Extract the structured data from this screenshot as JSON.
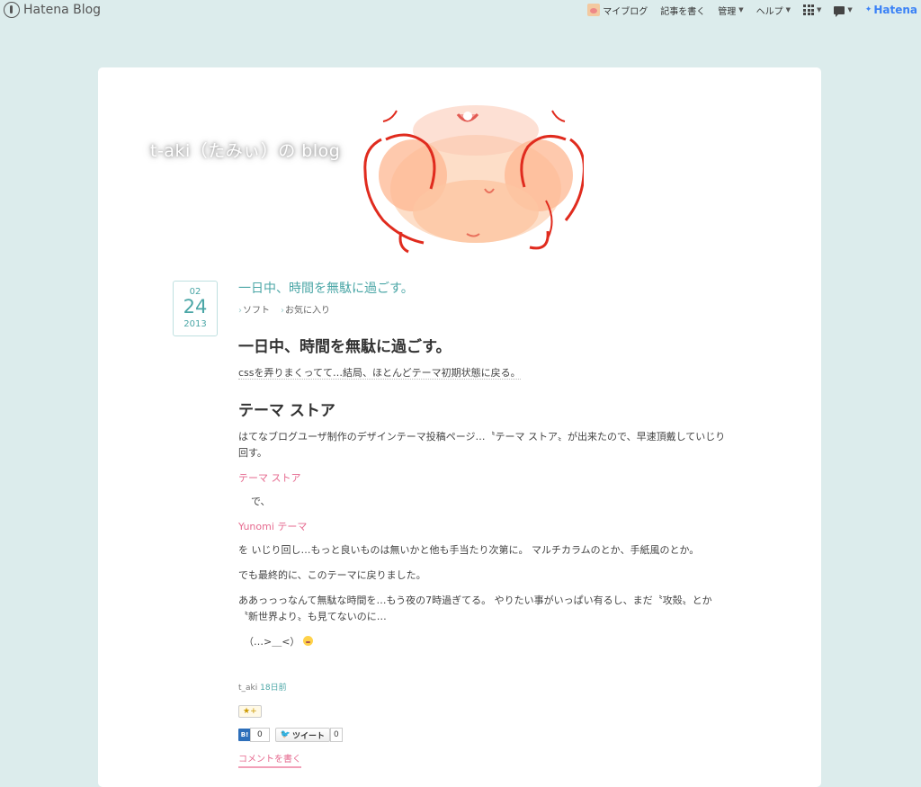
{
  "topbar": {
    "brand": "Hatena Blog",
    "nav": {
      "my_blog": "マイブログ",
      "write": "記事を書く",
      "manage": "管理",
      "help": "ヘルプ",
      "hatena": "Hatena"
    }
  },
  "blog": {
    "title": "t-aki（たみぃ）の blog"
  },
  "entry": {
    "date": {
      "month": "02",
      "day": "24",
      "year": "2013"
    },
    "title": "一日中、時間を無駄に過ごす。",
    "categories": [
      "ソフト",
      "お気に入り"
    ],
    "heading": "一日中、時間を無駄に過ごす。",
    "intro": "cssを弄りまくってて…結局、ほとんどテーマ初期状態に戻る。",
    "subheading": "テーマ ストア",
    "para1": "はてなブログユーザ制作のデザインテーマ投稿ページ…〝テーマ ストア〟が出来たので、早速頂戴していじり回す。",
    "link1": "テーマ ストア",
    "connector": "で、",
    "link2": "Yunomi テーマ",
    "para2": "を いじり回し…もっと良いものは無いかと他も手当たり次第に。 マルチカラムのとか、手紙風のとか。",
    "para3": "でも最終的に、このテーマに戻りました。",
    "para4": "ああっっっなんて無駄な時間を…もう夜の7時過ぎてる。 やりたい事がいっぱい有るし、まだ〝攻殻〟とか〝新世界より〟も見てないのに…",
    "face": "（…>＿<）",
    "author": "t_aki",
    "time_ago": "18日前",
    "star_label": "★+",
    "hatebu_logo": "B!",
    "hatebu_count": "0",
    "tweet_label": "ツイート",
    "tweet_count": "0",
    "comment_label": "コメントを書く"
  }
}
